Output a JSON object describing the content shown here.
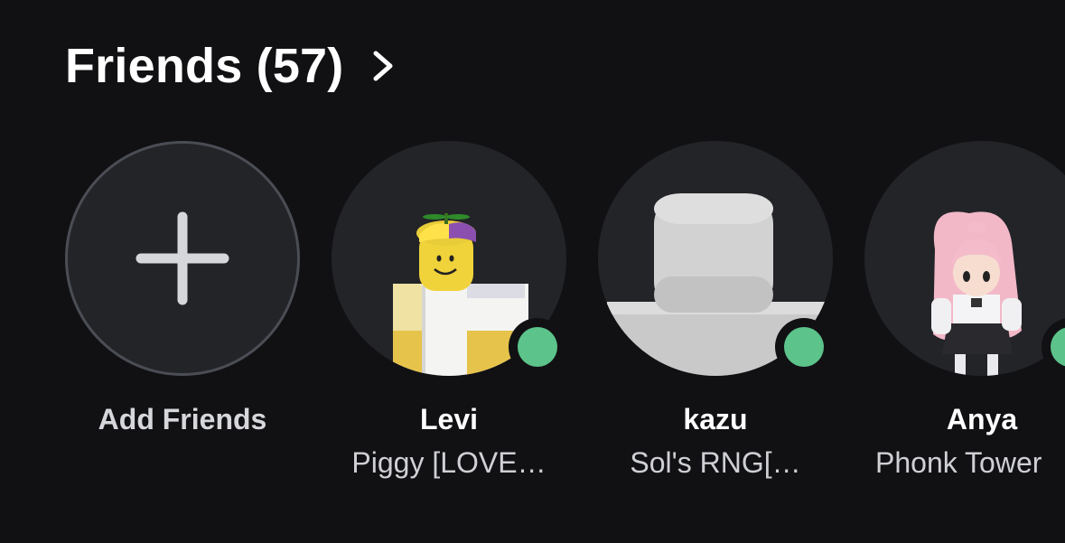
{
  "header": {
    "title": "Friends (57)",
    "chevron_icon": "chevron-right-icon"
  },
  "add_friends": {
    "label": "Add Friends",
    "icon": "plus-icon"
  },
  "friends": [
    {
      "name": "Levi",
      "status": "Piggy [LOVE…",
      "online": true,
      "presence_color": "#5cc38a"
    },
    {
      "name": "kazu",
      "status": "Sol's RNG[…",
      "online": true,
      "presence_color": "#5cc38a"
    },
    {
      "name": "Anya",
      "status": "Phonk Tower",
      "online": true,
      "presence_color": "#5cc38a"
    }
  ],
  "colors": {
    "background": "#111114",
    "circle": "#232428",
    "circle_border": "#4b4d55",
    "online": "#5cc38a"
  }
}
